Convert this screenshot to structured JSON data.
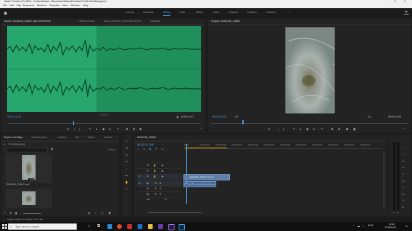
{
  "titlebar": {
    "text": "Adobe Premiere Pro 2021 - C:\\Users\\Dwan\\...\\Documents\\Adobe\\Premiere Pro\\15.0\\Untitled.prproj *",
    "controls": "–  ☐  ✕"
  },
  "menu": [
    "File",
    "Edit",
    "Clip",
    "Sequence",
    "Markers",
    "Graphics",
    "View",
    "Window",
    "Help"
  ],
  "workspaces": [
    {
      "label": "Learning",
      "active": false
    },
    {
      "label": "Assembly",
      "active": false
    },
    {
      "label": "Editing",
      "active": true
    },
    {
      "label": "Color",
      "active": false
    },
    {
      "label": "Effects",
      "active": false
    },
    {
      "label": "Audio",
      "active": false
    },
    {
      "label": "Graphics",
      "active": false
    },
    {
      "label": "Captions",
      "active": false
    },
    {
      "label": "Libraries",
      "active": false
    }
  ],
  "workspace_more": "»",
  "source": {
    "tabs": [
      "Source: 20210428_133947.mp4: 00:00:00:00",
      "Effect Controls",
      "Audio Clip Mixer: 20210428_133947",
      "Metadata"
    ],
    "timecode_in": "00:00:14:18",
    "timecode_dur": "00:00:10:07",
    "fit": "1/1"
  },
  "program": {
    "tabs": [
      "Program: 20210428_133947"
    ],
    "timecode": "00:00:01:05",
    "fit": "Fit",
    "scale": "1/1",
    "duration": "00:00:14:09"
  },
  "project": {
    "tabs": [
      "Project: The Edge",
      "Media Browser",
      "Libraries",
      "Info",
      "Effects",
      "Markers"
    ],
    "project_name": "The Edge.prproj",
    "items_count": "2 Items",
    "clips": [
      {
        "name": "20210428_133947.mp4",
        "duration": "14:09"
      },
      {
        "name": "20210428_133947",
        "duration": ""
      }
    ]
  },
  "timeline": {
    "tab": "20210428_133947",
    "timecode": "00:00:01:05",
    "ruler": [
      ":00:00",
      "00:00:04:29",
      "00:00:09:29",
      "00:00:14:29",
      "00:00:19:29",
      "00:00:24:29",
      "00:00:29:29",
      "00:00:34:29",
      "00:00:39:29",
      "00:00:44:29",
      "00:00:49:29",
      "00:00:54:29"
    ],
    "video_tracks": [
      "V3",
      "V2",
      "V1"
    ],
    "audio_tracks": [
      "A1",
      "A2",
      "A3"
    ],
    "mix_label": "Mix",
    "mix_value": "0.0",
    "video_clip_label": "20210428_133947.mp4 [V]",
    "audio_clip_label": ""
  },
  "meter_scale": [
    "0",
    "-6",
    "-12",
    "-18",
    "-24",
    "-30",
    "-36",
    "-42",
    "-48",
    "-54",
    "dB"
  ],
  "meter_solo": [
    "S",
    "S"
  ],
  "status_text": "Drag to adjust the length of the clip.",
  "taskbar": {
    "search_placeholder": "Type here to search",
    "time": "13:21",
    "date": "07/05/2021",
    "lang": "ENG"
  },
  "colors": {
    "accent": "#4aa3e8",
    "waveform_bg": "#1f8f5c",
    "clip_blue": "#5d7fa8",
    "playhead": "#f2c200",
    "audio_clip": "#4a6d9b"
  }
}
